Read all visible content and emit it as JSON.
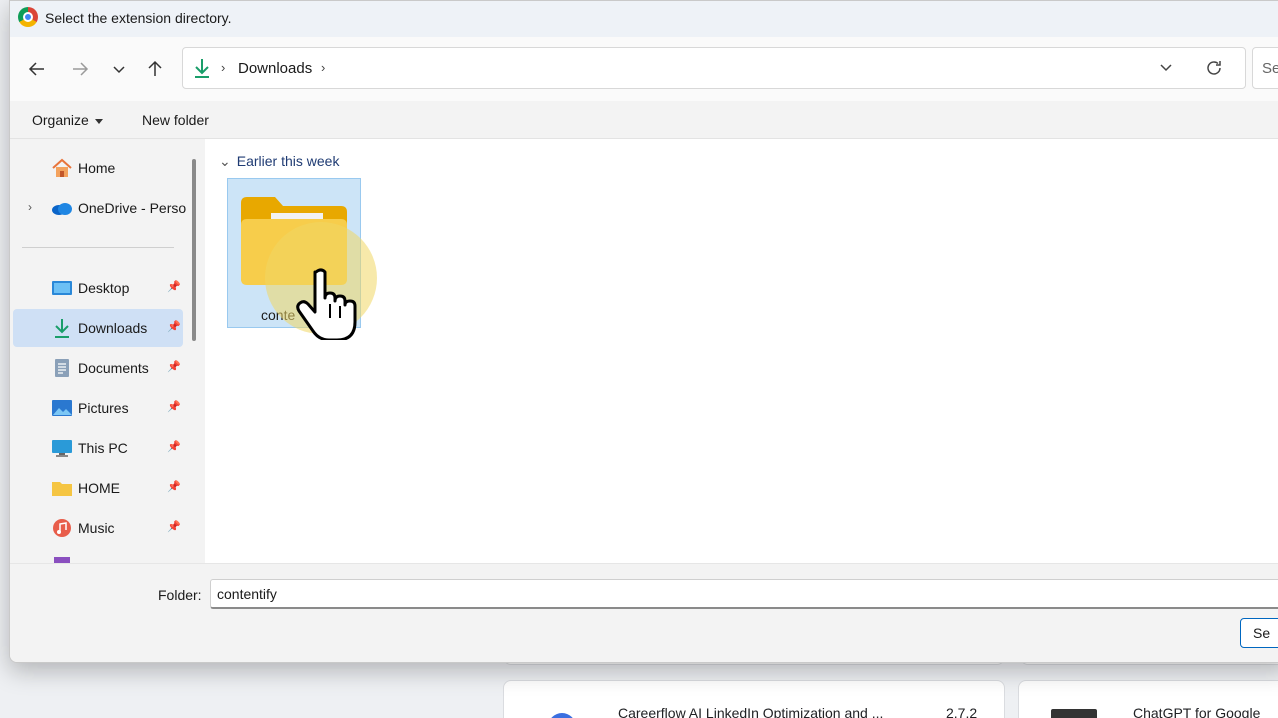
{
  "dialog": {
    "title": "Select the extension directory.",
    "address": {
      "crumb": "Downloads"
    },
    "search": {
      "placeholder": "Se"
    },
    "commands": {
      "organize": "Organize",
      "new_folder": "New folder"
    },
    "sidebar": {
      "items": [
        {
          "label": "Home",
          "icon": "home-icon"
        },
        {
          "label": "OneDrive - Perso",
          "icon": "onedrive-cloud-icon"
        },
        {
          "label": "Desktop",
          "icon": "desktop-icon"
        },
        {
          "label": "Downloads",
          "icon": "download-icon"
        },
        {
          "label": "Documents",
          "icon": "documents-icon"
        },
        {
          "label": "Pictures",
          "icon": "pictures-icon"
        },
        {
          "label": "This PC",
          "icon": "monitor-icon"
        },
        {
          "label": "HOME",
          "icon": "folder-icon"
        },
        {
          "label": "Music",
          "icon": "music-icon"
        }
      ]
    },
    "content": {
      "group_label": "Earlier this week",
      "folder_name": "conte"
    },
    "bottom": {
      "folder_label": "Folder:",
      "folder_value": "contentify",
      "select_label": "Se"
    }
  },
  "background": {
    "cards": [
      {
        "title": "Careerflow AI LinkedIn Optimization and ...",
        "version": "2.7.2"
      },
      {
        "title": "ChatGPT for Google"
      }
    ]
  },
  "colors": {
    "accent": "#0067c0",
    "selected_bg": "#cce4f7",
    "folder": "#f5c542"
  }
}
